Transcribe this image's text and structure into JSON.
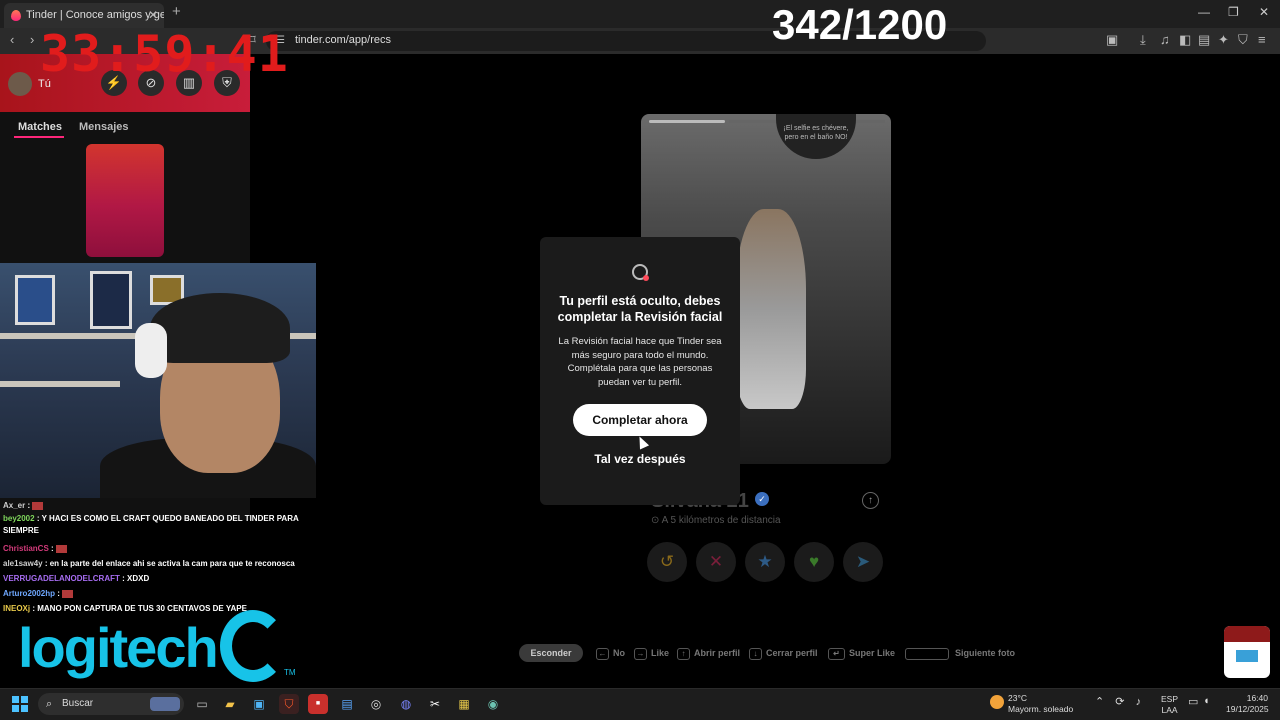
{
  "browser": {
    "tab_title": "Tinder | Conoce amigos y gente",
    "tab_close": "✕",
    "new_tab": "+",
    "url": "tinder.com/app/recs",
    "win_minimize": "—",
    "win_restore": "❐",
    "win_close": "✕"
  },
  "overlay": {
    "timer": "33:59:41",
    "counter": "342/1200"
  },
  "sidebar": {
    "user_label": "Tú",
    "tabs": [
      "Matches",
      "Mensajes"
    ]
  },
  "chat": [
    {
      "user": "Ax_er",
      "text": "",
      "user_color": "#cfcfcf",
      "has_emote": true
    },
    {
      "user": "bey2002",
      "text": "Y HACI ES COMO EL CRAFT QUEDO BANEADO DEL TINDER PARA SIEMPRE",
      "user_color": "#7fd65b",
      "has_emote": false
    },
    {
      "user": "ChristianCS",
      "text": "",
      "user_color": "#d23a7a",
      "has_emote": true
    },
    {
      "user": "ale1saw4y",
      "text": "en la parte del enlace ahi se activa la cam para que te reconosca",
      "user_color": "#cfcfcf",
      "has_emote": false
    },
    {
      "user": "VERRUGADELANODELCRAFT",
      "text": "XDXD",
      "user_color": "#a66cf0",
      "has_emote": false
    },
    {
      "user": "Arturo2002hp",
      "text": "",
      "user_color": "#6fa8ff",
      "has_emote": true
    },
    {
      "user": "INEOXj",
      "text": "MANO PON CAPTURA DE TUS 30 CENTAVOS DE YAPE",
      "user_color": "#e8c94a",
      "has_emote": false
    }
  ],
  "brand": {
    "logitech": "logitech",
    "tm": "TM"
  },
  "profile": {
    "name": "Silvana 21",
    "distance": "A 5 kilómetros de distancia",
    "photo_caption": "¡El selfie es chévere, pero en el baño NO!"
  },
  "modal": {
    "title": "Tu perfil está oculto, debes completar la Revisión facial",
    "body": "La Revisión facial hace que Tinder sea más seguro para todo el mundo. Complétala para que las personas puedan ver tu perfil.",
    "primary_button": "Completar ahora",
    "secondary_button": "Tal vez después"
  },
  "shortcuts": {
    "hide": "Esconder",
    "items": [
      "No",
      "Like",
      "Abrir perfil",
      "Cerrar perfil",
      "Super Like",
      "Siguiente foto"
    ]
  },
  "taskbar": {
    "search_placeholder": "Buscar",
    "temperature": "23°C",
    "weather": "Mayorm. soleado",
    "lang_top": "ESP",
    "lang_bottom": "LAA",
    "time": "16:40",
    "date": "19/12/2025"
  }
}
